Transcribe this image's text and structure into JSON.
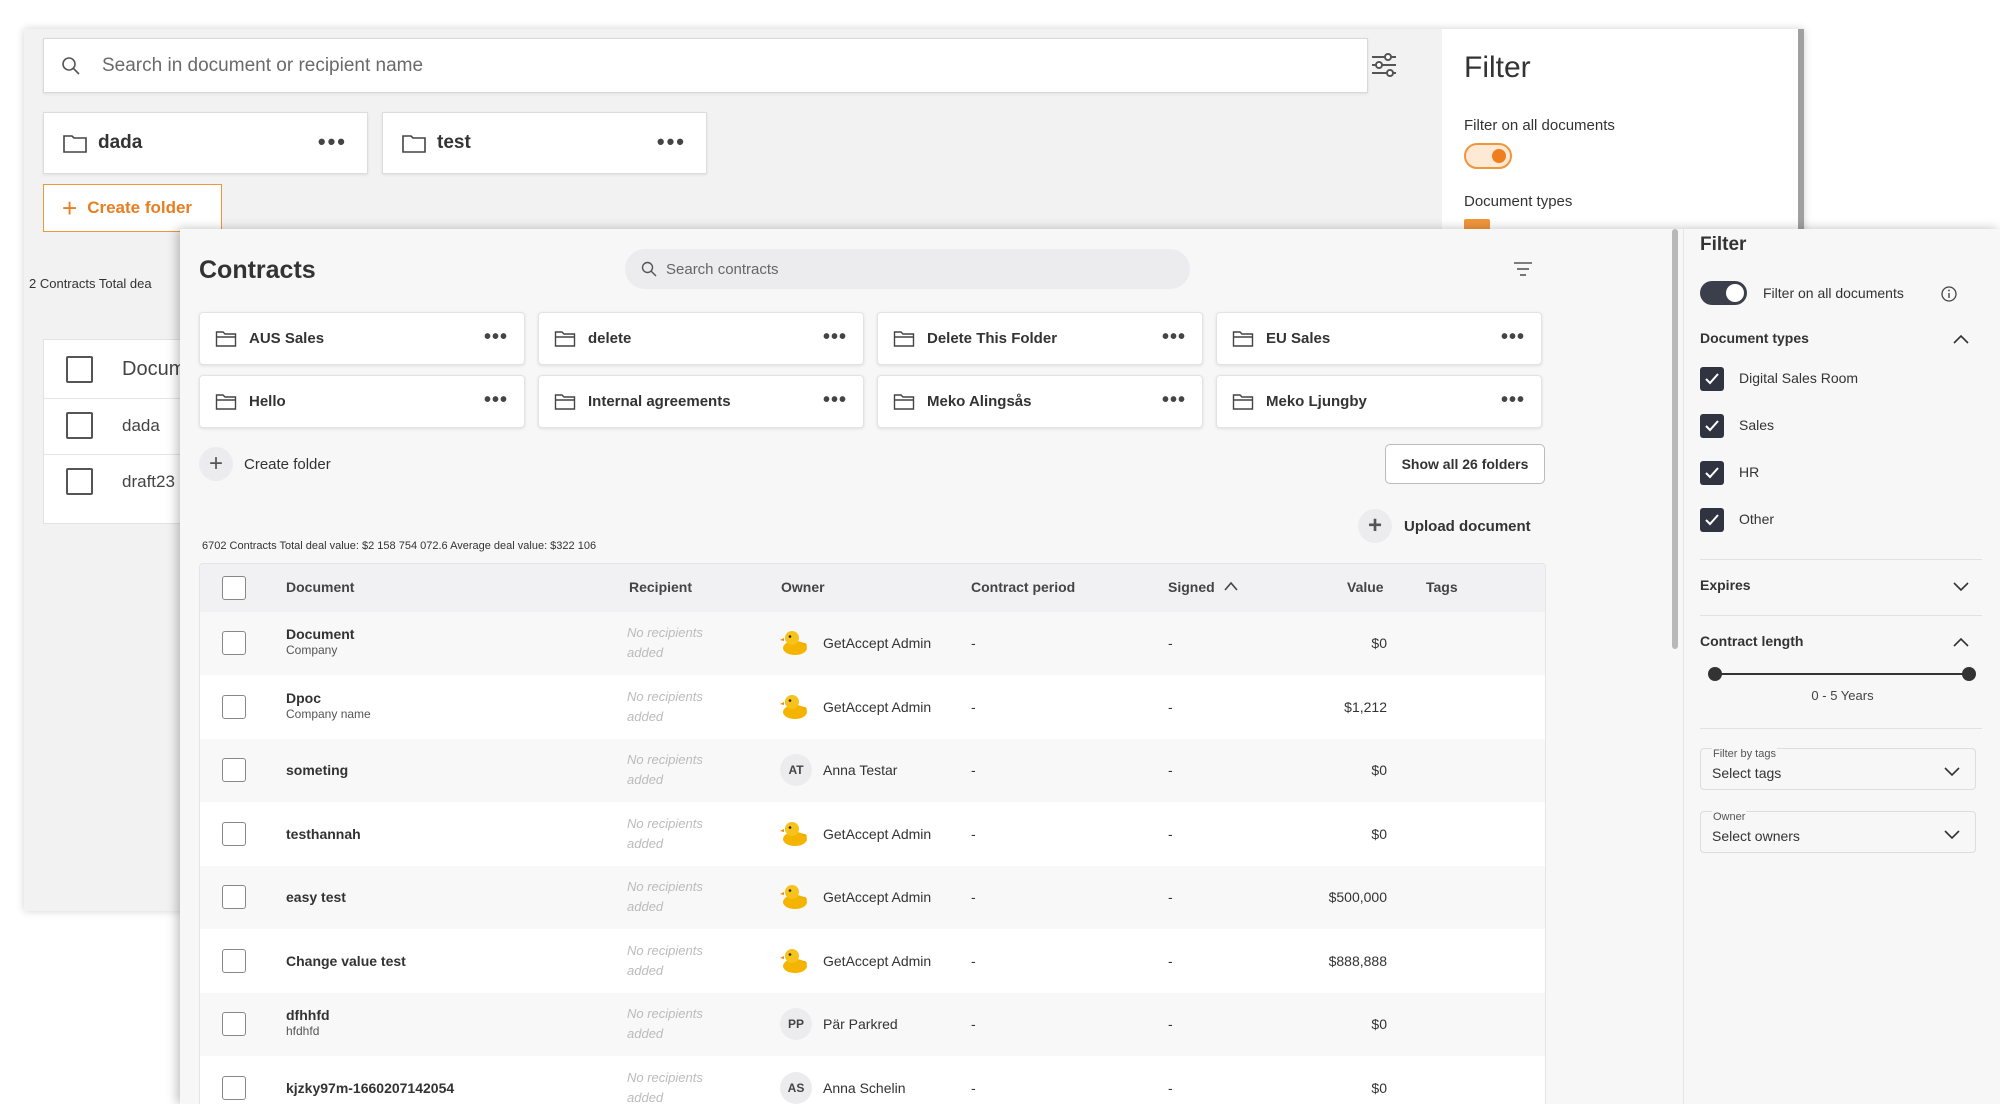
{
  "back": {
    "search_placeholder": "Search in document or recipient name",
    "folders": [
      {
        "name": "dada"
      },
      {
        "name": "test"
      }
    ],
    "create_folder": "Create folder",
    "stats": "2 Contracts  Total dea",
    "table_header": "Docum",
    "rows": [
      "dada",
      "draft23"
    ],
    "filter": {
      "title": "Filter",
      "filter_all": "Filter on all documents",
      "doc_types": "Document types"
    }
  },
  "front": {
    "title": "Contracts",
    "search_placeholder": "Search contracts",
    "folders": [
      {
        "name": "AUS Sales"
      },
      {
        "name": "delete"
      },
      {
        "name": "Delete This Folder"
      },
      {
        "name": "EU Sales"
      },
      {
        "name": "Hello"
      },
      {
        "name": "Internal agreements"
      },
      {
        "name": "Meko Alingsås"
      },
      {
        "name": "Meko Ljungby"
      }
    ],
    "create_folder": "Create folder",
    "show_all_folders": "Show all 26 folders",
    "stats": "6702 Contracts   Total deal value: $2 158 754 072.6   Average deal value: $322 106",
    "upload": "Upload document",
    "columns": {
      "document": "Document",
      "recipient": "Recipient",
      "owner": "Owner",
      "period": "Contract period",
      "signed": "Signed",
      "value": "Value",
      "tags": "Tags"
    },
    "rows": [
      {
        "doc": "Document",
        "sub": "Company",
        "recipient": "No recipients added",
        "avatar": "duck",
        "owner": "GetAccept Admin",
        "period": "-",
        "signed": "-",
        "value": "$0"
      },
      {
        "doc": "Dpoc",
        "sub": "Company name",
        "recipient": "No recipients added",
        "avatar": "duck",
        "owner": "GetAccept Admin",
        "period": "-",
        "signed": "-",
        "value": "$1,212"
      },
      {
        "doc": "someting",
        "sub": "",
        "recipient": "No recipients added",
        "avatar": "AT",
        "owner": "Anna Testar",
        "period": "-",
        "signed": "-",
        "value": "$0"
      },
      {
        "doc": "testhannah",
        "sub": "",
        "recipient": "No recipients added",
        "avatar": "duck",
        "owner": "GetAccept Admin",
        "period": "-",
        "signed": "-",
        "value": "$0"
      },
      {
        "doc": "easy test",
        "sub": "",
        "recipient": "No recipients added",
        "avatar": "duck",
        "owner": "GetAccept Admin",
        "period": "-",
        "signed": "-",
        "value": "$500,000"
      },
      {
        "doc": "Change value test",
        "sub": "",
        "recipient": "No recipients added",
        "avatar": "duck",
        "owner": "GetAccept Admin",
        "period": "-",
        "signed": "-",
        "value": "$888,888"
      },
      {
        "doc": "dfhhfd",
        "sub": "hfdhfd",
        "recipient": "No recipients added",
        "avatar": "PP",
        "owner": "Pär Parkred",
        "period": "-",
        "signed": "-",
        "value": "$0"
      },
      {
        "doc": "kjzky97m-1660207142054",
        "sub": "",
        "recipient": "No recipients added",
        "avatar": "AS",
        "owner": "Anna Schelin",
        "period": "-",
        "signed": "-",
        "value": "$0"
      }
    ],
    "filter": {
      "title": "Filter",
      "filter_all": "Filter on all documents",
      "doc_types": "Document types",
      "types": [
        "Digital Sales Room",
        "Sales",
        "HR",
        "Other"
      ],
      "expires": "Expires",
      "contract_length": "Contract length",
      "length_range": "0 - 5 Years",
      "tags_label": "Filter by tags",
      "tags_value": "Select tags",
      "owner_label": "Owner",
      "owner_value": "Select owners"
    }
  },
  "colors": {
    "accent_orange": "#f0963a",
    "dark_check": "#2f3440"
  }
}
